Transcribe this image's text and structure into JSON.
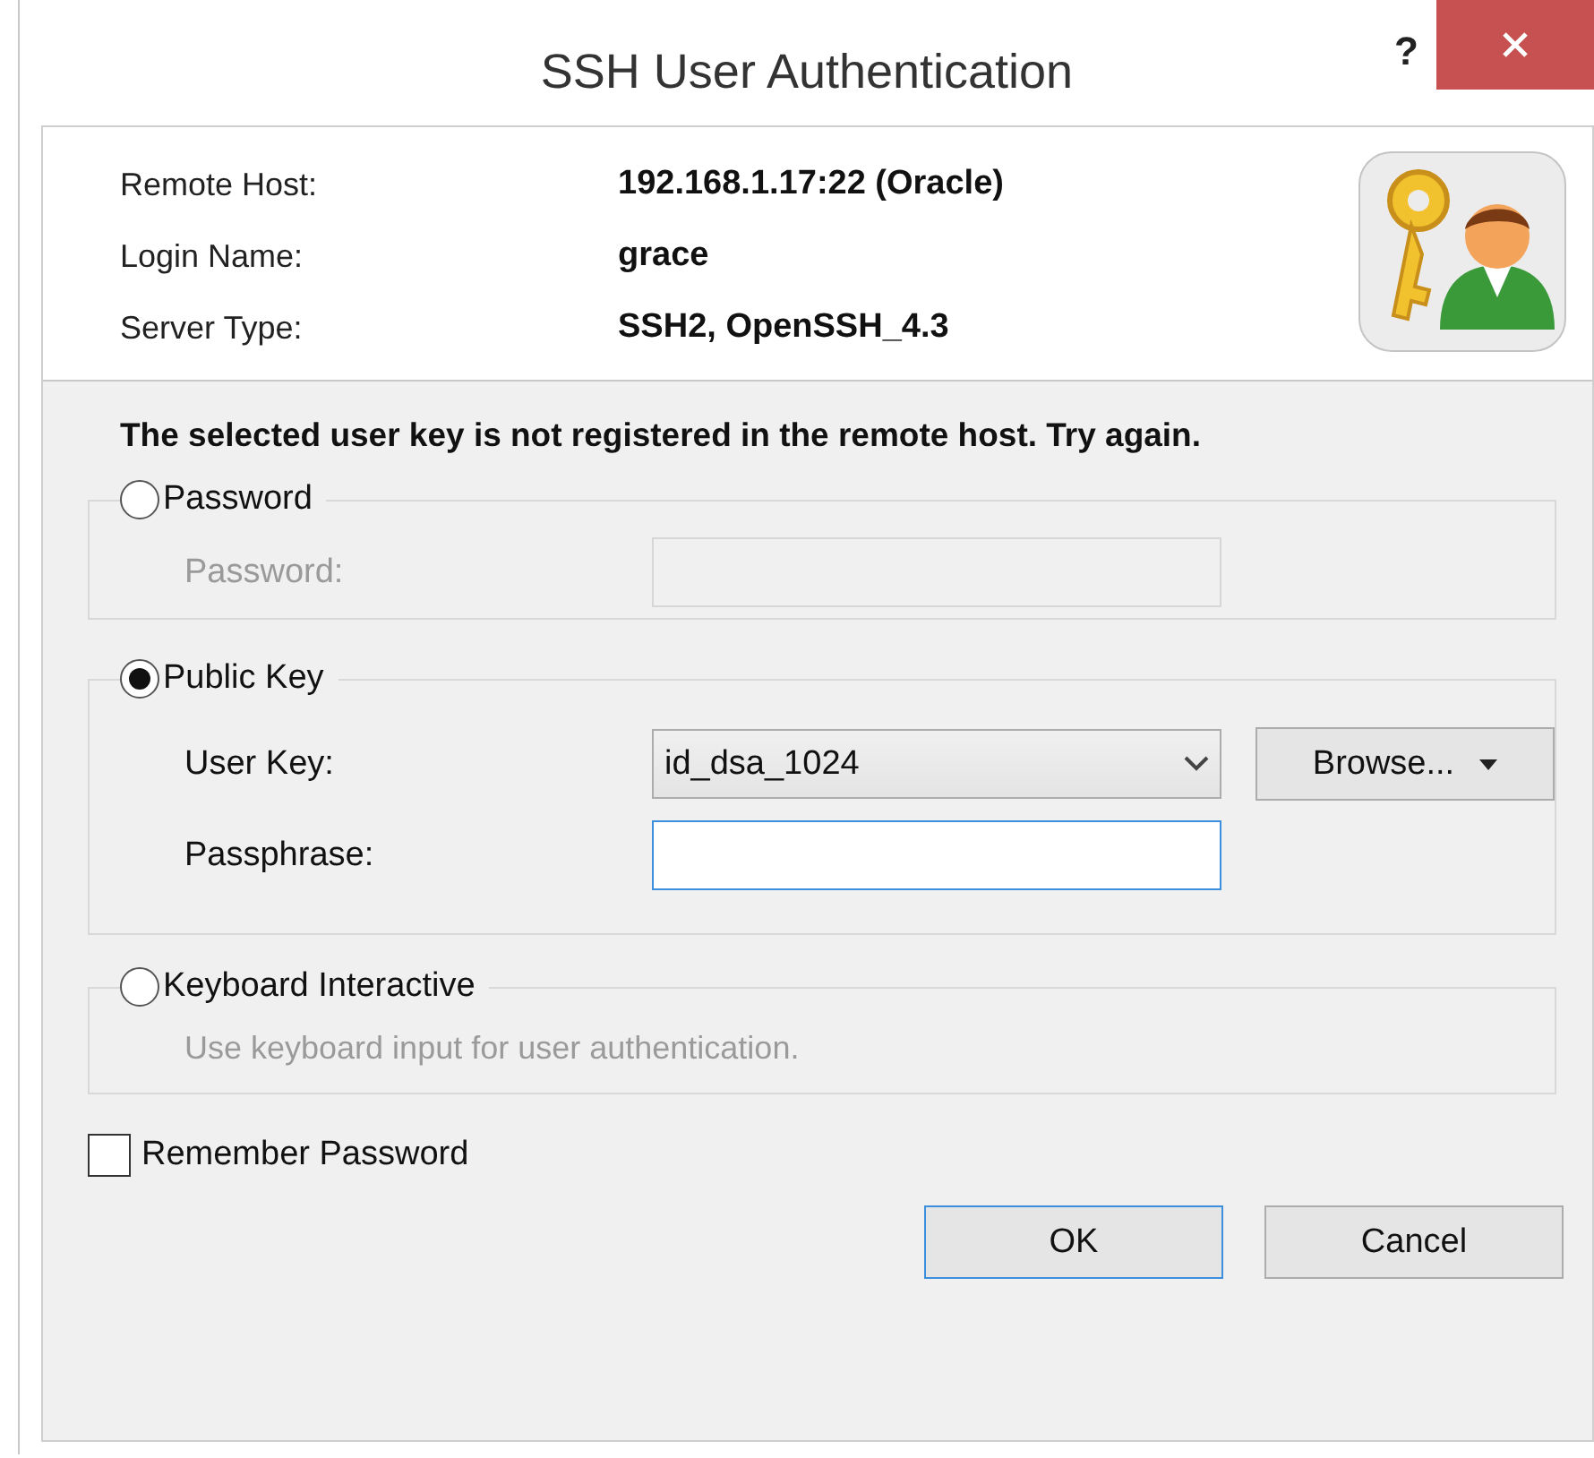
{
  "window": {
    "title": "SSH User Authentication",
    "help": "?"
  },
  "info": [
    {
      "label": "Remote Host:",
      "value": "192.168.1.17:22 (Oracle)"
    },
    {
      "label": "Login Name:",
      "value": "grace"
    },
    {
      "label": "Server Type:",
      "value": "SSH2, OpenSSH_4.3"
    }
  ],
  "message": "The selected user key is not registered in the remote host. Try again.",
  "methods": [
    {
      "label": "Password",
      "selected": false,
      "kind": "fields",
      "fields": [
        {
          "label": "Password:",
          "kind": "text",
          "disabled": true,
          "focused": false
        }
      ]
    },
    {
      "label": "Public Key",
      "selected": true,
      "kind": "fields",
      "fields": [
        {
          "label": "User Key:",
          "kind": "select",
          "value": "id_dsa_1024",
          "disabled": false,
          "button": "Browse..."
        },
        {
          "label": "Passphrase:",
          "kind": "text",
          "disabled": false,
          "focused": true
        }
      ]
    },
    {
      "label": "Keyboard Interactive",
      "selected": false,
      "kind": "note",
      "note": "Use keyboard input for user authentication.",
      "disabled": true
    }
  ],
  "remember": {
    "label": "Remember Password",
    "checked": false
  },
  "buttons": [
    {
      "label": "OK",
      "default": true
    },
    {
      "label": "Cancel",
      "default": false
    }
  ]
}
